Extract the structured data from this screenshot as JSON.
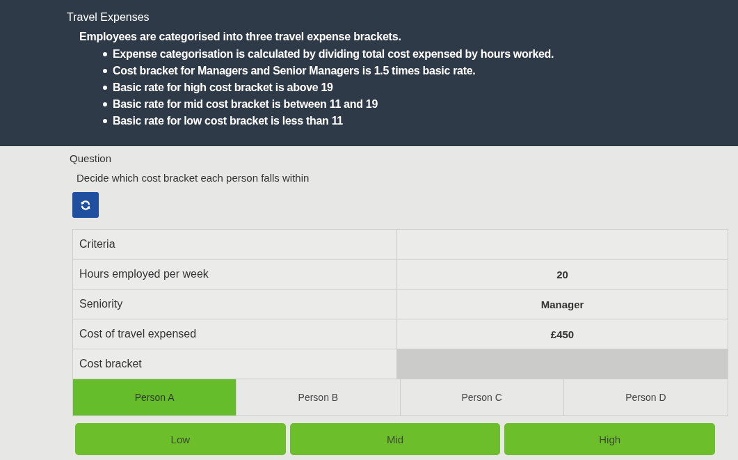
{
  "header": {
    "title": "Travel Expenses",
    "intro": "Employees are categorised into three travel expense brackets.",
    "bullets": [
      "Expense categorisation is calculated by dividing total cost expensed by hours worked.",
      "Cost bracket for Managers and Senior Managers is 1.5 times basic rate.",
      "Basic rate for high cost bracket is above 19",
      "Basic rate for mid cost bracket is between 11 and 19",
      "Basic rate for low cost bracket is less than 11"
    ]
  },
  "question": {
    "label": "Question",
    "text": "Decide which cost bracket each person falls within"
  },
  "table": {
    "column_1": "Criteria",
    "rows": [
      {
        "kind": "value",
        "label": "Hours employed per week",
        "value": "20"
      },
      {
        "kind": "value",
        "label": "Seniority",
        "value": "Manager"
      },
      {
        "kind": "value",
        "label": "Cost of travel expensed",
        "value": "£450"
      },
      {
        "kind": "dropzone",
        "label": "Cost bracket"
      }
    ]
  },
  "persons": [
    {
      "label": "Person A",
      "selected": true
    },
    {
      "label": "Person B",
      "selected": false
    },
    {
      "label": "Person C",
      "selected": false
    },
    {
      "label": "Person D",
      "selected": false
    }
  ],
  "answers": [
    "Low",
    "Mid",
    "High"
  ]
}
